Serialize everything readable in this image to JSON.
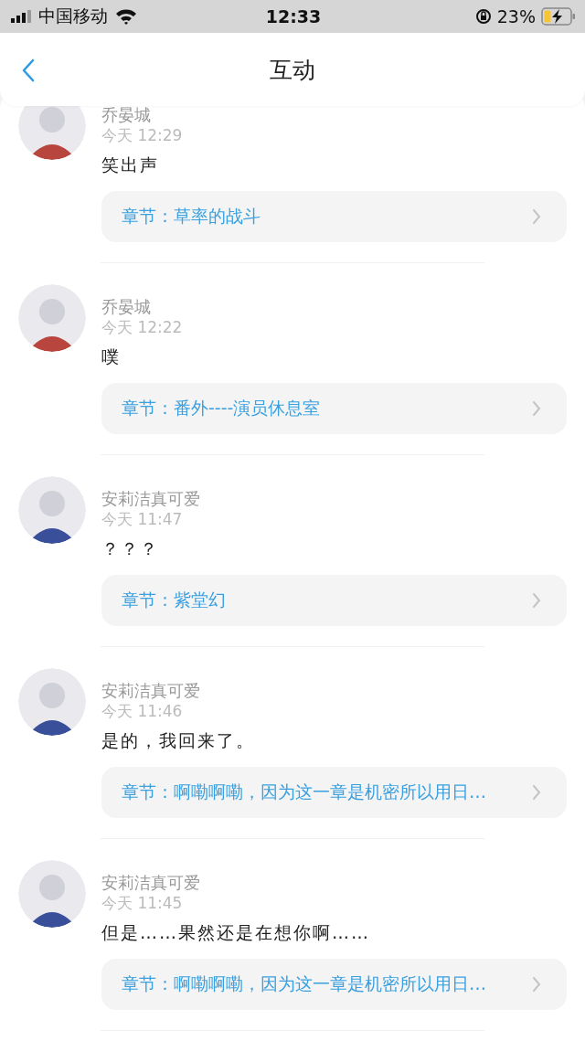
{
  "status_bar": {
    "carrier": "中国移动",
    "time": "12:33",
    "battery": "23%"
  },
  "header": {
    "title": "互动"
  },
  "comments": [
    {
      "name": "乔晏城",
      "time": "今天 12:29",
      "message": "笑出声",
      "chapter": "章节：草率的战斗",
      "color": "#b8463e"
    },
    {
      "name": "乔晏城",
      "time": "今天 12:22",
      "message": "噗",
      "chapter": "章节：番外----演员休息室",
      "color": "#b8463e"
    },
    {
      "name": "安莉洁真可爱",
      "time": "今天 11:47",
      "message": "？？？",
      "chapter": "章节：紫堂幻",
      "color": "#3a4f9a"
    },
    {
      "name": "安莉洁真可爱",
      "time": "今天 11:46",
      "message": "是的，我回来了。",
      "chapter": "章节：啊嘞啊嘞，因为这一章是机密所以用日…",
      "color": "#3a4f9a"
    },
    {
      "name": "安莉洁真可爱",
      "time": "今天 11:45",
      "message": "但是……果然还是在想你啊……",
      "chapter": "章节：啊嘞啊嘞，因为这一章是机密所以用日…",
      "color": "#3a4f9a"
    }
  ]
}
